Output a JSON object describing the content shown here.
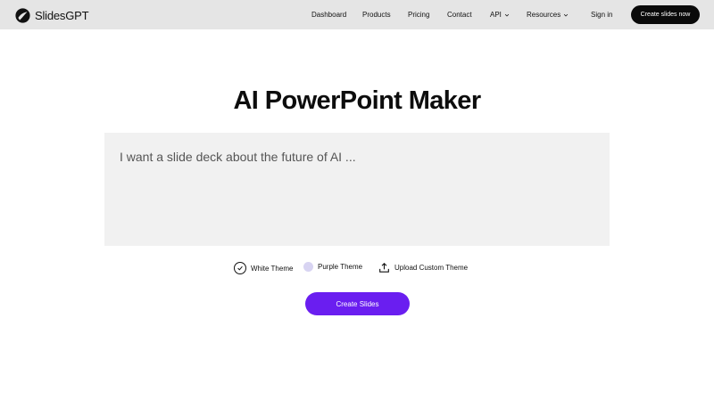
{
  "brand": {
    "name": "SlidesGPT",
    "logo_icon": "slidesgpt-logo-icon"
  },
  "nav": {
    "items": [
      {
        "label": "Dashboard"
      },
      {
        "label": "Products"
      },
      {
        "label": "Pricing"
      },
      {
        "label": "Contact"
      },
      {
        "label": "API",
        "icon": "chevron-down-icon"
      },
      {
        "label": "Resources",
        "icon": "chevron-down-icon"
      }
    ],
    "signin": "Sign in",
    "cta": "Create slides now"
  },
  "main": {
    "title": "AI PowerPoint Maker",
    "prompt_placeholder": "I want a slide deck about the future of AI ...",
    "themes": [
      {
        "label": "White Theme",
        "selected": true,
        "icon": "check-circle-icon"
      },
      {
        "label": "Purple Theme",
        "selected": false,
        "swatch": "#d8d4f2"
      },
      {
        "label": "Upload Custom Theme",
        "icon": "upload-icon"
      }
    ],
    "create_button": "Create Slides"
  },
  "colors": {
    "header_bg": "#e5e5e5",
    "cta_bg": "#0a0a0a",
    "accent": "#6a1ef0",
    "prompt_bg": "#f1f1f1"
  }
}
